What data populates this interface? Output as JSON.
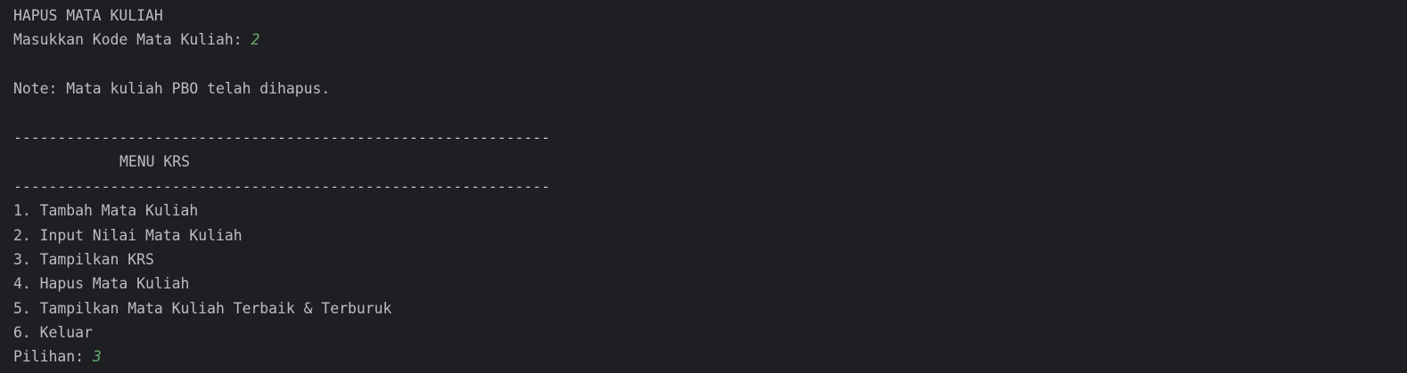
{
  "console": {
    "header": "HAPUS MATA KULIAH",
    "prompt_kode": {
      "label": "Masukkan Kode Mata Kuliah: ",
      "input": "2"
    },
    "note": "Note: Mata kuliah PBO telah dihapus.",
    "separator": "-------------------------------------------------------------",
    "menu_title": "MENU KRS",
    "menu_items": [
      "1. Tambah Mata Kuliah",
      "2. Input Nilai Mata Kuliah",
      "3. Tampilkan KRS",
      "4. Hapus Mata Kuliah",
      "5. Tampilkan Mata Kuliah Terbaik & Terburuk",
      "6. Keluar"
    ],
    "prompt_pilihan": {
      "label": "Pilihan: ",
      "input": "3"
    }
  },
  "colors": {
    "background": "#1e1f22",
    "text": "#bcbec4",
    "user_input": "#6aab73"
  }
}
